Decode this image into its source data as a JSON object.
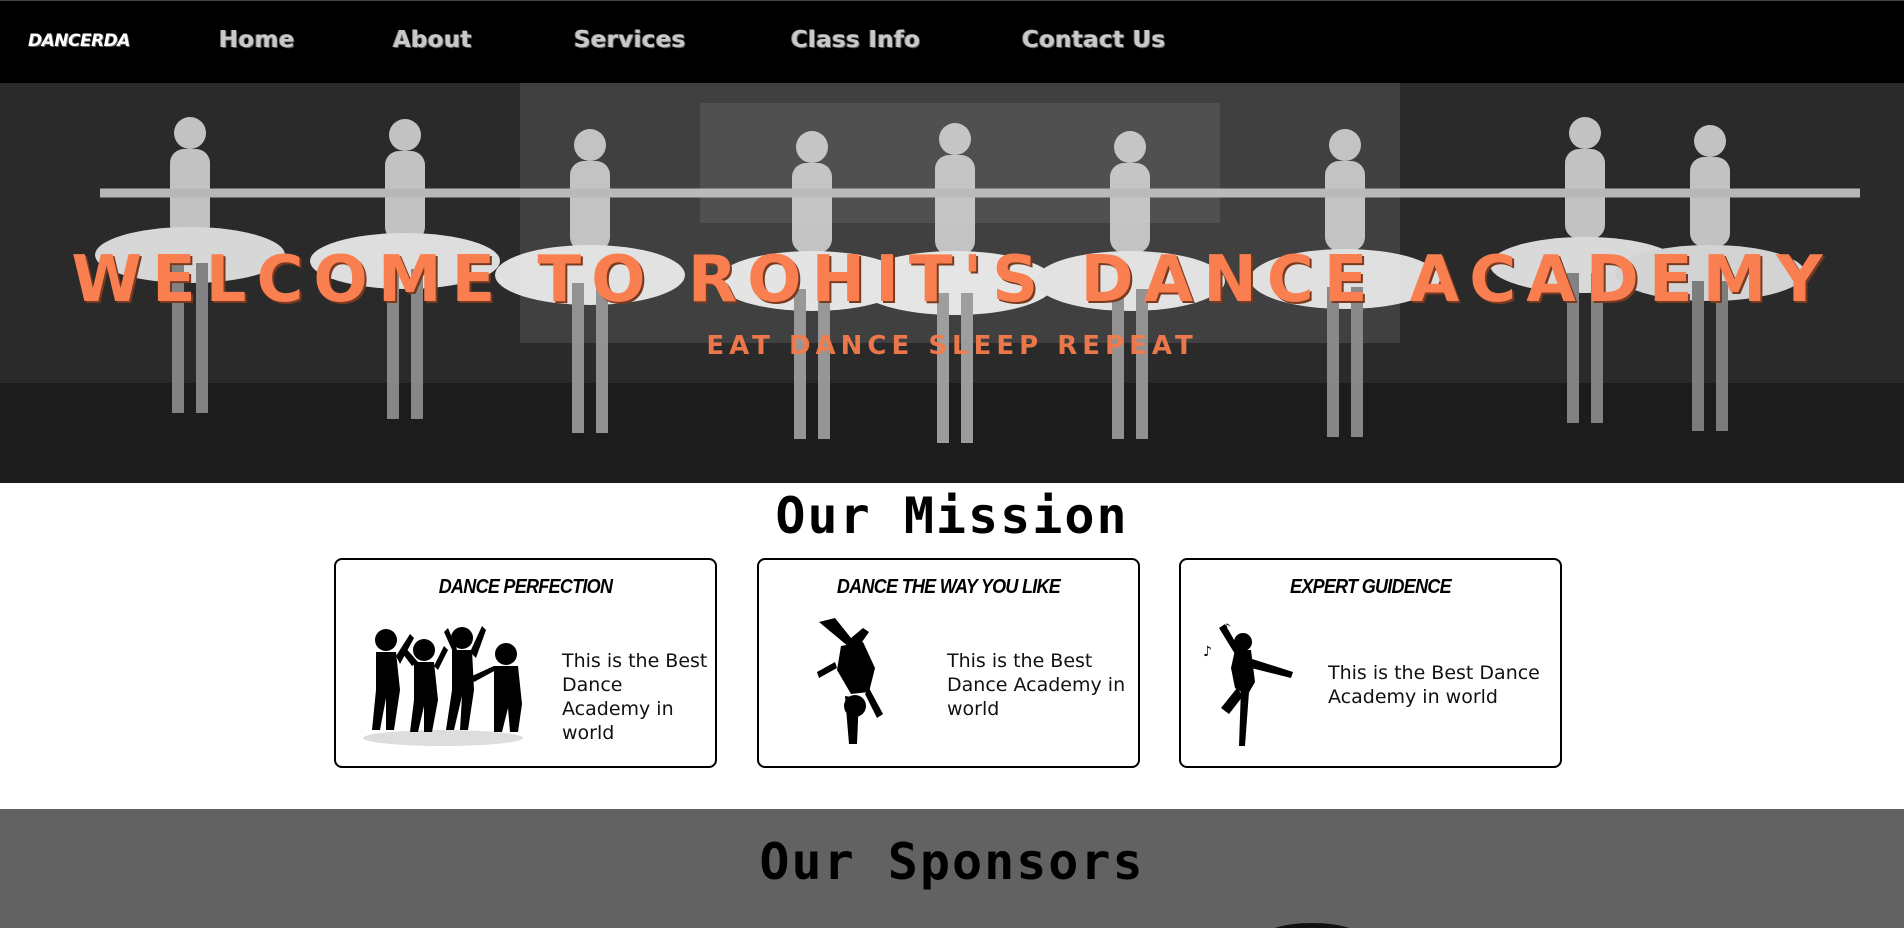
{
  "navbar": {
    "logo_text": "DANCERDA",
    "links": [
      "Home",
      "About",
      "Services",
      "Class Info",
      "Contact Us"
    ]
  },
  "hero": {
    "title": "WELCOME TO ROHIT'S DANCE ACADEMY",
    "subtitle": "EAT DANCE SLEEP REPEAT",
    "image_icon": "ballet-dancers-photo"
  },
  "mission": {
    "title": "Our Mission",
    "cards": [
      {
        "title": "DANCE PERFECTION",
        "text": "This is the Best Dance Academy in world",
        "icon": "kids-dancing-silhouette-icon"
      },
      {
        "title": "DANCE THE WAY YOU LIKE",
        "text": "This is the Best Dance Academy in world",
        "icon": "breakdancer-silhouette-icon"
      },
      {
        "title": "EXPERT GUIDENCE",
        "text": "This is the Best Dance Academy in world",
        "icon": "dancer-silhouette-icon"
      }
    ]
  },
  "sponsors": {
    "title": "Our Sponsors"
  },
  "colors": {
    "accent": "#fa7f50",
    "navbar_bg": "#000000",
    "sponsors_bg": "#636262"
  }
}
